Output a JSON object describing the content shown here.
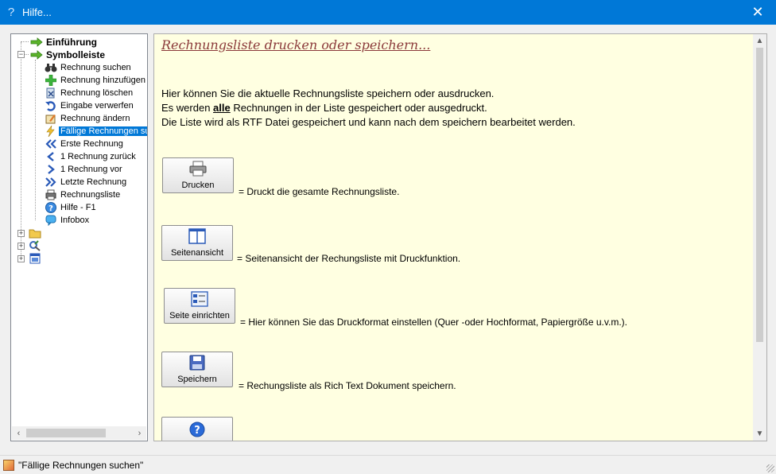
{
  "window": {
    "title": "Hilfe...",
    "title_icon": "question-icon",
    "close_glyph": "✕"
  },
  "tree": {
    "top_nodes": [
      {
        "label": "Einführung",
        "icon": "green-arrow-icon"
      },
      {
        "label": "Symbolleiste",
        "icon": "green-arrow-icon"
      }
    ],
    "children": [
      {
        "label": "Rechnung suchen",
        "icon": "binoculars-icon"
      },
      {
        "label": "Rechnung hinzufügen",
        "icon": "plus-icon"
      },
      {
        "label": "Rechnung löschen",
        "icon": "delete-icon"
      },
      {
        "label": "Eingabe verwerfen",
        "icon": "undo-icon"
      },
      {
        "label": "Rechnung ändern",
        "icon": "edit-icon"
      },
      {
        "label": "Fällige Rechnungen su",
        "icon": "lightning-icon"
      },
      {
        "label": "Erste Rechnung",
        "icon": "first-icon"
      },
      {
        "label": "1 Rechnung zurück",
        "icon": "prev-icon"
      },
      {
        "label": "1 Rechnung vor",
        "icon": "next-icon"
      },
      {
        "label": "Letzte Rechnung",
        "icon": "last-icon"
      },
      {
        "label": "Rechnungsliste",
        "icon": "printer-icon"
      },
      {
        "label": "Hilfe - F1",
        "icon": "help-icon"
      },
      {
        "label": "Infobox",
        "icon": "info-bubble-icon"
      }
    ],
    "collapsed_nodes": [
      {
        "icon": "folder-icon"
      },
      {
        "icon": "tools-icon"
      },
      {
        "icon": "window-icon"
      }
    ],
    "selected_index": 5
  },
  "content": {
    "heading": "Rechnungsliste drucken oder speichern...",
    "line1": "Hier können Sie die aktuelle Rechnungsliste speichern oder ausdrucken.",
    "line2_pre": "Es werden ",
    "line2_bold": "alle",
    "line2_post": " Rechnungen in der Liste gespeichert oder ausgedruckt.",
    "line3": "Die Liste wird als RTF Datei gespeichert und kann nach dem speichern bearbeitet werden.",
    "buttons": [
      {
        "label": "Drucken",
        "icon": "printer-icon",
        "desc": "= Druckt die gesamte Rechnungsliste."
      },
      {
        "label": "Seitenansicht",
        "icon": "page-view-icon",
        "desc": " = Seitenansicht der Rechungsliste mit Druckfunktion."
      },
      {
        "label": "Seite einrichten",
        "icon": "page-setup-icon",
        "desc": "= Hier können Sie das Druckformat  einstellen (Quer -oder Hochformat, Papiergröße u.v.m.)."
      },
      {
        "label": "Speichern",
        "icon": "save-icon",
        "desc": "= Rechungsliste als Rich Text Dokument speichern."
      },
      {
        "label": "",
        "icon": "help-icon",
        "desc": ""
      }
    ]
  },
  "status": {
    "text": "\"Fällige Rechnungen suchen\""
  },
  "colors": {
    "titlebar": "#0078d7",
    "content_bg": "#ffffe1",
    "heading": "#8b3a3a",
    "selection": "#0078d7"
  }
}
